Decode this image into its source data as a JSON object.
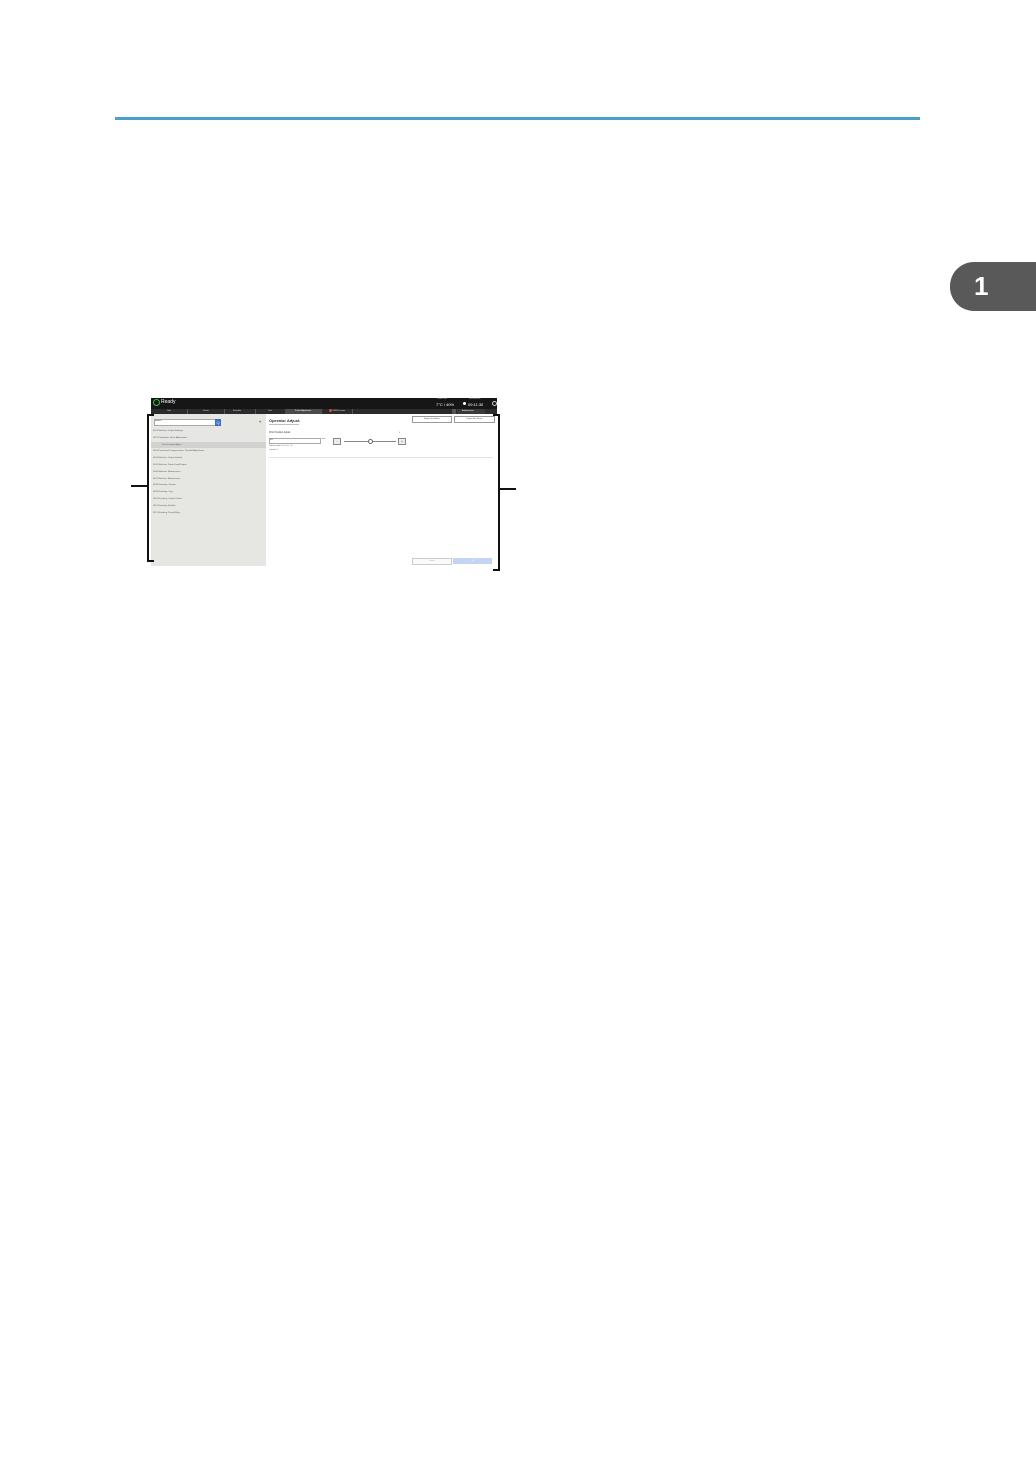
{
  "page": {
    "chapter_number": "1"
  },
  "figure": {
    "status": {
      "ready_label": "Ready",
      "temp_label": "Printer Env.",
      "temp_value": "7°C / 40%",
      "time_label": "Maintenance",
      "time_value": "09:11:30"
    },
    "tabs": [
      "Jobs",
      "Printer",
      "Schedule",
      "Tool",
      "Printer Adjustment",
      "SPM Function"
    ],
    "user_label": "Administrator",
    "search": {
      "placeholder": "Search",
      "button": "Q"
    },
    "tree": [
      {
        "label": "0101 Machine: Output Settings",
        "indent": false,
        "selected": false
      },
      {
        "label": "0102 Printheads: Basic Adjustment",
        "indent": false,
        "selected": false
      },
      {
        "label": "Print Position Adjust",
        "indent": true,
        "selected": true
      },
      {
        "label": "0103 Print Head Compensation: Detailed Adjustment",
        "indent": false,
        "selected": false
      },
      {
        "label": "0104 Machine: Output Quality",
        "indent": false,
        "selected": false
      },
      {
        "label": "0105 Machine: Paper Feed/Output",
        "indent": false,
        "selected": false
      },
      {
        "label": "0106 Machine: Maintenance",
        "indent": false,
        "selected": false
      },
      {
        "label": "0107 Machine: Maintenance",
        "indent": false,
        "selected": false
      },
      {
        "label": "0108 Finishing: Stacker",
        "indent": false,
        "selected": false
      },
      {
        "label": "0109 Finishing: Tray",
        "indent": false,
        "selected": false
      },
      {
        "label": "0110 Finishing: Output Others",
        "indent": false,
        "selected": false
      },
      {
        "label": "0111 Finishing: Booklet",
        "indent": false,
        "selected": false
      },
      {
        "label": "0112 Finishing: Punch/Ring",
        "indent": false,
        "selected": false
      }
    ],
    "pane": {
      "title": "Operator Adjust.",
      "btn_export": "Export Set Values",
      "btn_import": "Import Set Values",
      "field_label": "Print Position Adjust",
      "field_value": "0.0",
      "unit": "mm",
      "minus": "-",
      "plus": "+",
      "slider_value": "0",
      "range": "Default value: 0.0 / (-5 - 5)",
      "current": "Current: 0",
      "cancel": "Cancel",
      "ok": "OK"
    }
  }
}
